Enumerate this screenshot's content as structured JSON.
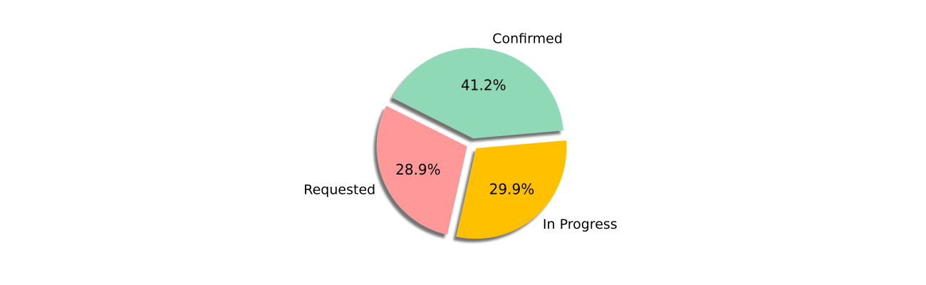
{
  "chart_data": {
    "type": "pie",
    "title": "",
    "slices": [
      {
        "label": "Confirmed",
        "percent_label": "41.2%",
        "value": 41.2,
        "color": "#8fd9b6"
      },
      {
        "label": "Requested",
        "percent_label": "28.9%",
        "value": 28.9,
        "color": "#ff9999"
      },
      {
        "label": "In Progress",
        "percent_label": "29.9%",
        "value": 29.9,
        "color": "#ffc000"
      }
    ],
    "start_angle_deg": 5,
    "direction": "counterclockwise",
    "exploded": true,
    "shadow": true
  }
}
